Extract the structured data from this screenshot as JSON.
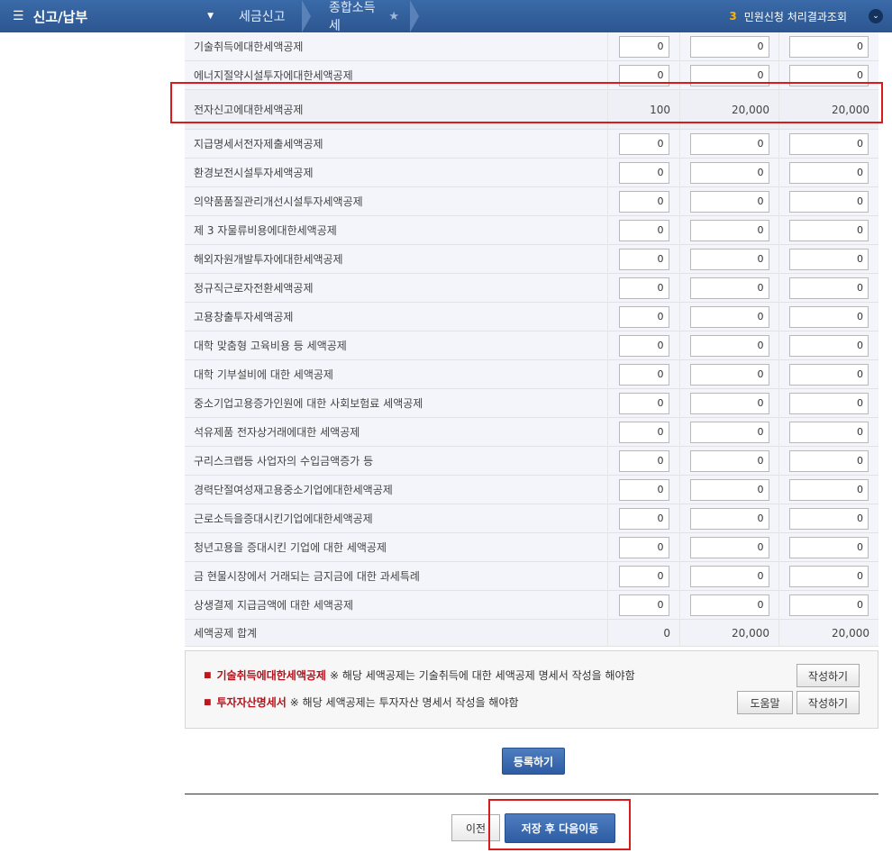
{
  "topbar": {
    "menu_icon": "hamburger-icon",
    "menu_label": "신고/납부",
    "breadcrumb": [
      "세금신고",
      "종합소득세"
    ],
    "favorite_icon": "star-icon",
    "right_count": "3",
    "right_label": "민원신청 처리결과조회",
    "expand_icon": "chevron-down-icon"
  },
  "rows_top": [
    {
      "label": "기술취득에대한세액공제",
      "a": "0",
      "b": "0",
      "c": "0"
    },
    {
      "label": "에너지절약시설투자에대한세액공제",
      "a": "0",
      "b": "0",
      "c": "0"
    }
  ],
  "highlight_row": {
    "label": "전자신고에대한세액공제",
    "a": "100",
    "b": "20,000",
    "c": "20,000"
  },
  "rows": [
    {
      "label": "지급명세서전자제출세액공제",
      "a": "0",
      "b": "0",
      "c": "0"
    },
    {
      "label": "환경보전시설투자세액공제",
      "a": "0",
      "b": "0",
      "c": "0"
    },
    {
      "label": "의약품품질관리개선시설투자세액공제",
      "a": "0",
      "b": "0",
      "c": "0"
    },
    {
      "label": "제 3 자물류비용에대한세액공제",
      "a": "0",
      "b": "0",
      "c": "0"
    },
    {
      "label": "해외자원개발투자에대한세액공제",
      "a": "0",
      "b": "0",
      "c": "0"
    },
    {
      "label": "정규직근로자전환세액공제",
      "a": "0",
      "b": "0",
      "c": "0"
    },
    {
      "label": "고용창출투자세액공제",
      "a": "0",
      "b": "0",
      "c": "0"
    },
    {
      "label": "대학 맞춤형 고육비용 등 세액공제",
      "a": "0",
      "b": "0",
      "c": "0"
    },
    {
      "label": "대학 기부설비에 대한 세액공제",
      "a": "0",
      "b": "0",
      "c": "0"
    },
    {
      "label": "중소기업고용증가인원에 대한 사회보험료 세액공제",
      "a": "0",
      "b": "0",
      "c": "0"
    },
    {
      "label": "석유제품 전자상거래에대한 세액공제",
      "a": "0",
      "b": "0",
      "c": "0"
    },
    {
      "label": "구리스크랩등 사업자의 수입금액증가 등",
      "a": "0",
      "b": "0",
      "c": "0"
    },
    {
      "label": "경력단절여성재고용중소기업에대한세액공제",
      "a": "0",
      "b": "0",
      "c": "0"
    },
    {
      "label": "근로소득을증대시킨기업에대한세액공제",
      "a": "0",
      "b": "0",
      "c": "0"
    },
    {
      "label": "청년고용을 증대시킨 기업에 대한 세액공제",
      "a": "0",
      "b": "0",
      "c": "0"
    },
    {
      "label": "금 현물시장에서 거래되는 금지금에 대한 과세특례",
      "a": "0",
      "b": "0",
      "c": "0"
    },
    {
      "label": "상생결제 지급금액에 대한 세액공제",
      "a": "0",
      "b": "0",
      "c": "0"
    }
  ],
  "total_row": {
    "label": "세액공제 합계",
    "a": "0",
    "b": "20,000",
    "c": "20,000"
  },
  "notice": {
    "line1_title": "기술취득에대한세액공제",
    "line1_text": "※ 해당 세액공제는 기술취득에 대한 세액공제 명세서 작성을 해야함",
    "line2_title": "투자자산명세서",
    "line2_text": "※ 해당 세액공제는 투자자산 명세서 작성을 해야함",
    "write_label": "작성하기",
    "help_label": "도움말"
  },
  "buttons": {
    "register": "등록하기",
    "prev": "이전",
    "save_next": "저장 후 다음이동"
  }
}
